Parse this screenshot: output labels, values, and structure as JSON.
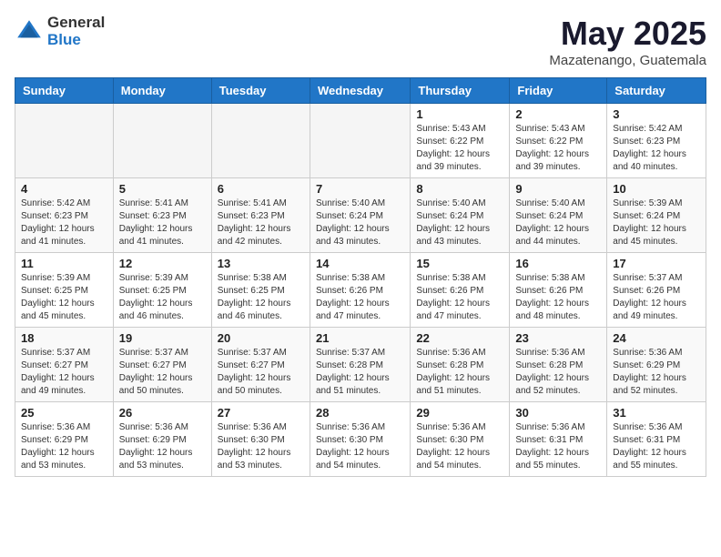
{
  "logo": {
    "general": "General",
    "blue": "Blue"
  },
  "title": {
    "month_year": "May 2025",
    "location": "Mazatenango, Guatemala"
  },
  "weekdays": [
    "Sunday",
    "Monday",
    "Tuesday",
    "Wednesday",
    "Thursday",
    "Friday",
    "Saturday"
  ],
  "weeks": [
    [
      {
        "day": "",
        "info": ""
      },
      {
        "day": "",
        "info": ""
      },
      {
        "day": "",
        "info": ""
      },
      {
        "day": "",
        "info": ""
      },
      {
        "day": "1",
        "info": "Sunrise: 5:43 AM\nSunset: 6:22 PM\nDaylight: 12 hours\nand 39 minutes."
      },
      {
        "day": "2",
        "info": "Sunrise: 5:43 AM\nSunset: 6:22 PM\nDaylight: 12 hours\nand 39 minutes."
      },
      {
        "day": "3",
        "info": "Sunrise: 5:42 AM\nSunset: 6:23 PM\nDaylight: 12 hours\nand 40 minutes."
      }
    ],
    [
      {
        "day": "4",
        "info": "Sunrise: 5:42 AM\nSunset: 6:23 PM\nDaylight: 12 hours\nand 41 minutes."
      },
      {
        "day": "5",
        "info": "Sunrise: 5:41 AM\nSunset: 6:23 PM\nDaylight: 12 hours\nand 41 minutes."
      },
      {
        "day": "6",
        "info": "Sunrise: 5:41 AM\nSunset: 6:23 PM\nDaylight: 12 hours\nand 42 minutes."
      },
      {
        "day": "7",
        "info": "Sunrise: 5:40 AM\nSunset: 6:24 PM\nDaylight: 12 hours\nand 43 minutes."
      },
      {
        "day": "8",
        "info": "Sunrise: 5:40 AM\nSunset: 6:24 PM\nDaylight: 12 hours\nand 43 minutes."
      },
      {
        "day": "9",
        "info": "Sunrise: 5:40 AM\nSunset: 6:24 PM\nDaylight: 12 hours\nand 44 minutes."
      },
      {
        "day": "10",
        "info": "Sunrise: 5:39 AM\nSunset: 6:24 PM\nDaylight: 12 hours\nand 45 minutes."
      }
    ],
    [
      {
        "day": "11",
        "info": "Sunrise: 5:39 AM\nSunset: 6:25 PM\nDaylight: 12 hours\nand 45 minutes."
      },
      {
        "day": "12",
        "info": "Sunrise: 5:39 AM\nSunset: 6:25 PM\nDaylight: 12 hours\nand 46 minutes."
      },
      {
        "day": "13",
        "info": "Sunrise: 5:38 AM\nSunset: 6:25 PM\nDaylight: 12 hours\nand 46 minutes."
      },
      {
        "day": "14",
        "info": "Sunrise: 5:38 AM\nSunset: 6:26 PM\nDaylight: 12 hours\nand 47 minutes."
      },
      {
        "day": "15",
        "info": "Sunrise: 5:38 AM\nSunset: 6:26 PM\nDaylight: 12 hours\nand 47 minutes."
      },
      {
        "day": "16",
        "info": "Sunrise: 5:38 AM\nSunset: 6:26 PM\nDaylight: 12 hours\nand 48 minutes."
      },
      {
        "day": "17",
        "info": "Sunrise: 5:37 AM\nSunset: 6:26 PM\nDaylight: 12 hours\nand 49 minutes."
      }
    ],
    [
      {
        "day": "18",
        "info": "Sunrise: 5:37 AM\nSunset: 6:27 PM\nDaylight: 12 hours\nand 49 minutes."
      },
      {
        "day": "19",
        "info": "Sunrise: 5:37 AM\nSunset: 6:27 PM\nDaylight: 12 hours\nand 50 minutes."
      },
      {
        "day": "20",
        "info": "Sunrise: 5:37 AM\nSunset: 6:27 PM\nDaylight: 12 hours\nand 50 minutes."
      },
      {
        "day": "21",
        "info": "Sunrise: 5:37 AM\nSunset: 6:28 PM\nDaylight: 12 hours\nand 51 minutes."
      },
      {
        "day": "22",
        "info": "Sunrise: 5:36 AM\nSunset: 6:28 PM\nDaylight: 12 hours\nand 51 minutes."
      },
      {
        "day": "23",
        "info": "Sunrise: 5:36 AM\nSunset: 6:28 PM\nDaylight: 12 hours\nand 52 minutes."
      },
      {
        "day": "24",
        "info": "Sunrise: 5:36 AM\nSunset: 6:29 PM\nDaylight: 12 hours\nand 52 minutes."
      }
    ],
    [
      {
        "day": "25",
        "info": "Sunrise: 5:36 AM\nSunset: 6:29 PM\nDaylight: 12 hours\nand 53 minutes."
      },
      {
        "day": "26",
        "info": "Sunrise: 5:36 AM\nSunset: 6:29 PM\nDaylight: 12 hours\nand 53 minutes."
      },
      {
        "day": "27",
        "info": "Sunrise: 5:36 AM\nSunset: 6:30 PM\nDaylight: 12 hours\nand 53 minutes."
      },
      {
        "day": "28",
        "info": "Sunrise: 5:36 AM\nSunset: 6:30 PM\nDaylight: 12 hours\nand 54 minutes."
      },
      {
        "day": "29",
        "info": "Sunrise: 5:36 AM\nSunset: 6:30 PM\nDaylight: 12 hours\nand 54 minutes."
      },
      {
        "day": "30",
        "info": "Sunrise: 5:36 AM\nSunset: 6:31 PM\nDaylight: 12 hours\nand 55 minutes."
      },
      {
        "day": "31",
        "info": "Sunrise: 5:36 AM\nSunset: 6:31 PM\nDaylight: 12 hours\nand 55 minutes."
      }
    ]
  ]
}
